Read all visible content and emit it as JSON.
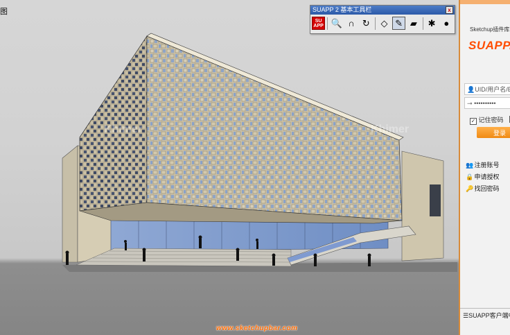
{
  "viewport": {
    "corner_label": "图",
    "watermark_url": "www.sketchupbar.com",
    "watermarks": [
      "Khimer",
      "Khimer"
    ]
  },
  "toolbar": {
    "title": "SUAPP 2 基本工具栏",
    "close_label": "x",
    "logo_text": [
      "SU",
      "APP"
    ],
    "tools": [
      {
        "name": "zoom-icon",
        "glyph": "🔍"
      },
      {
        "name": "magnet-icon",
        "glyph": "∩"
      },
      {
        "name": "rotate-icon",
        "glyph": "↻"
      },
      {
        "name": "eraser-icon",
        "glyph": "◇"
      },
      {
        "name": "edit-icon",
        "glyph": "✎"
      },
      {
        "name": "paint-icon",
        "glyph": "▰"
      },
      {
        "name": "settings-icon",
        "glyph": "✱"
      },
      {
        "name": "camera-icon",
        "glyph": "●"
      }
    ]
  },
  "panel": {
    "brand_small": "Sketchup插件库",
    "brand_logo": "SUAPP.",
    "uid_placeholder": "UID/用户名/Em",
    "password_value": "••••••••••",
    "remember_label": "记住密码",
    "login_label": "登录",
    "links": [
      {
        "label": "注册账号",
        "icon": "user-add-icon",
        "glyph": "👥"
      },
      {
        "label": "申请授权",
        "icon": "license-icon",
        "glyph": "🔒"
      },
      {
        "label": "找回密码",
        "icon": "key-icon",
        "glyph": "🔑"
      }
    ],
    "status_text": "☰SUAPP客户端中加"
  },
  "colors": {
    "accent": "#f08a14",
    "logo": "#ff4d00",
    "toolbar_title": "#2c5aa8"
  }
}
